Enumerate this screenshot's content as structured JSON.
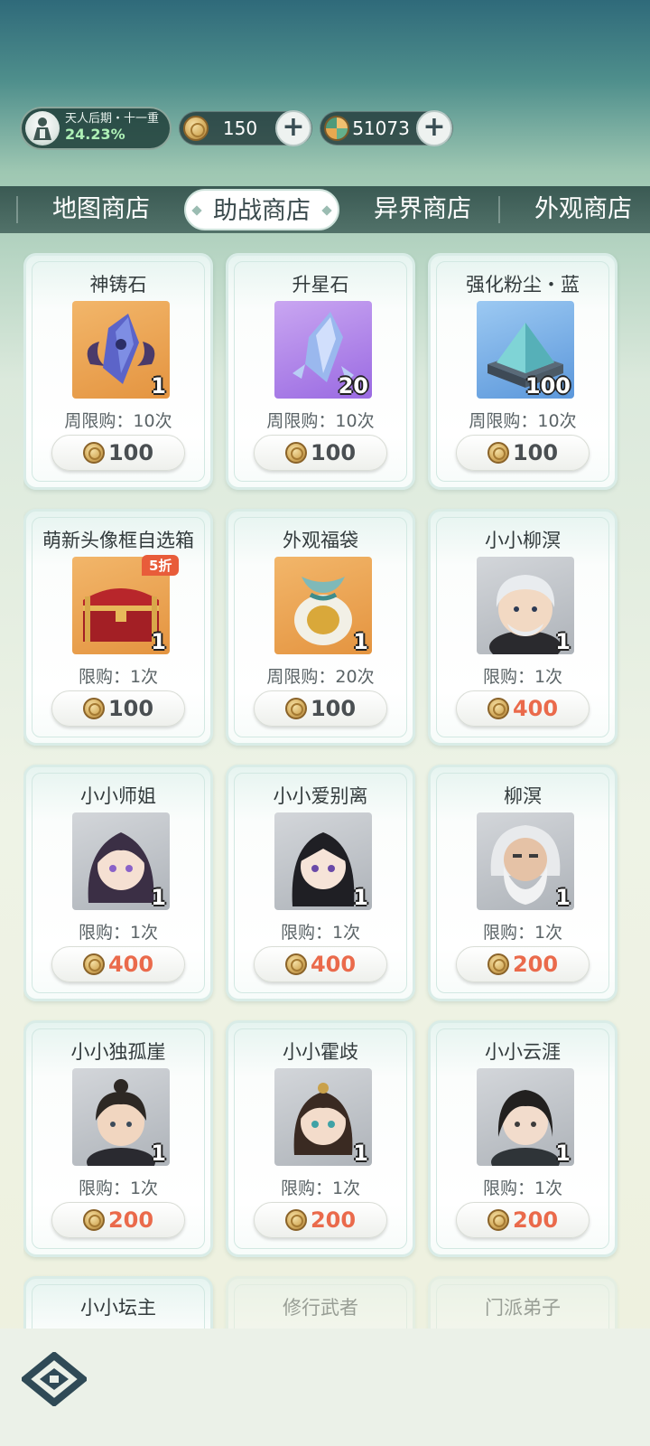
{
  "realm": {
    "title": "天人后期・十一重",
    "progress": "24.23%"
  },
  "currencies": [
    {
      "icon": "coin-icon",
      "value": "150"
    },
    {
      "icon": "jade-icon",
      "value": "51073"
    }
  ],
  "tabs": [
    "地图商店",
    "助战商店",
    "异界商店",
    "外观商店"
  ],
  "active_tab": "助战商店",
  "items": [
    {
      "name": "神铸石",
      "qty": "1",
      "limit": "周限购：10次",
      "price": "100",
      "thumb": "orange",
      "icon": "crystal-wing-icon"
    },
    {
      "name": "升星石",
      "qty": "20",
      "limit": "周限购：10次",
      "price": "100",
      "thumb": "purple",
      "icon": "star-stone-icon"
    },
    {
      "name": "强化粉尘・蓝",
      "qty": "100",
      "limit": "周限购：10次",
      "price": "100",
      "thumb": "blue",
      "icon": "dust-pile-icon"
    },
    {
      "name": "萌新头像框自选箱",
      "qty": "1",
      "limit": "限购：1次",
      "price": "100",
      "thumb": "orange",
      "icon": "treasure-chest-icon",
      "badge": "5折"
    },
    {
      "name": "外观福袋",
      "qty": "1",
      "limit": "周限购：20次",
      "price": "100",
      "thumb": "orange",
      "icon": "lucky-bag-icon"
    },
    {
      "name": "小小柳溟",
      "qty": "1",
      "limit": "限购：1次",
      "price": "400",
      "thumb": "gray",
      "icon": "avatar-white-hair-icon"
    },
    {
      "name": "小小师姐",
      "qty": "1",
      "limit": "限购：1次",
      "price": "400",
      "thumb": "gray",
      "icon": "avatar-purple-hair-icon"
    },
    {
      "name": "小小爱别离",
      "qty": "1",
      "limit": "限购：1次",
      "price": "400",
      "thumb": "gray",
      "icon": "avatar-black-hair-icon"
    },
    {
      "name": "柳溟",
      "qty": "1",
      "limit": "限购：1次",
      "price": "200",
      "thumb": "gray",
      "icon": "avatar-bearded-icon"
    },
    {
      "name": "小小独孤崖",
      "qty": "1",
      "limit": "限购：1次",
      "price": "200",
      "thumb": "gray",
      "icon": "avatar-topknot-icon"
    },
    {
      "name": "小小霍歧",
      "qty": "1",
      "limit": "限购：1次",
      "price": "200",
      "thumb": "gray",
      "icon": "avatar-bun-icon"
    },
    {
      "name": "小小云涯",
      "qty": "1",
      "limit": "限购：1次",
      "price": "200",
      "thumb": "gray",
      "icon": "avatar-scholar-icon"
    },
    {
      "name": "小小坛主",
      "partial": true
    },
    {
      "name": "修行武者",
      "partial": true,
      "faded": true
    },
    {
      "name": "门派弟子",
      "partial": true,
      "faded": true
    }
  ],
  "colors": {
    "price_normal": "#4a4f52",
    "price_hot": "#ea6a4b",
    "badge": "#e85c3a"
  }
}
